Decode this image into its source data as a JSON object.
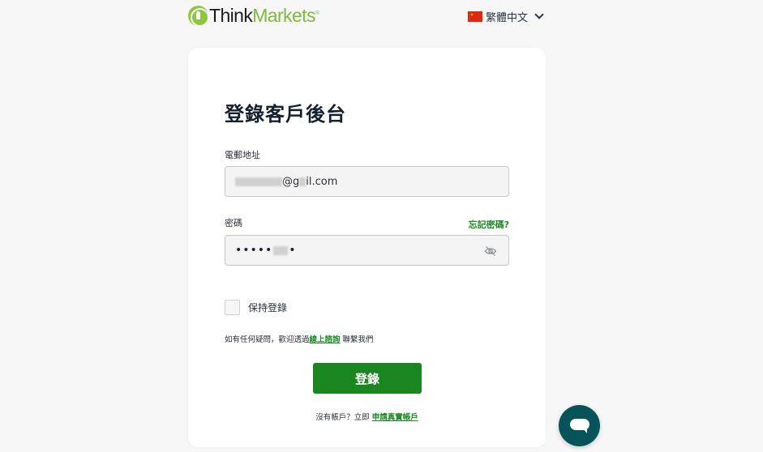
{
  "header": {
    "logo": {
      "part1": "Think",
      "part2": "Markets",
      "registered": "®"
    },
    "language": {
      "flag": "china-flag",
      "label": "繁體中文"
    }
  },
  "login": {
    "title": "登錄客戶後台",
    "email": {
      "label": "電郵地址",
      "value_visible_suffix": "il.com",
      "value_visible_mid": "@g"
    },
    "password": {
      "label": "密碼",
      "masked_value": "•••••",
      "masked_tail": "•",
      "forgot_label": "忘記密碼?"
    },
    "remember": {
      "label": "保持登錄",
      "checked": false
    },
    "help": {
      "prefix": "如有任何疑問，歡迎透過",
      "link": "線上諮詢",
      "suffix": " 聯繫我們"
    },
    "submit_label": "登錄",
    "signup": {
      "prefix": "沒有帳戶？立即 ",
      "link": "申請真實帳戶"
    }
  },
  "colors": {
    "accent_green": "#19861f",
    "link_green": "#1d8a26",
    "logo_green": "#7dbb3a",
    "chat_teal": "#065359"
  }
}
